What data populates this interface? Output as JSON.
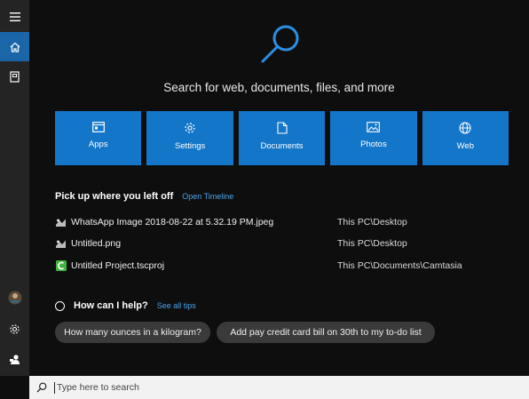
{
  "rail": {
    "items": [
      {
        "icon": "hamburger-menu-icon"
      },
      {
        "icon": "home-icon",
        "active": true
      },
      {
        "icon": "notebook-icon"
      },
      {
        "icon": "user-avatar-icon"
      },
      {
        "icon": "gear-icon"
      },
      {
        "icon": "feedback-icon"
      }
    ]
  },
  "main": {
    "headline": "Search for web, documents, files, and more",
    "tiles": [
      {
        "label": "Apps",
        "icon": "apps-icon"
      },
      {
        "label": "Settings",
        "icon": "settings-gear-icon"
      },
      {
        "label": "Documents",
        "icon": "document-icon"
      },
      {
        "label": "Photos",
        "icon": "photo-icon"
      },
      {
        "label": "Web",
        "icon": "globe-icon"
      }
    ],
    "recent": {
      "title": "Pick up where you left off",
      "link": "Open Timeline",
      "items": [
        {
          "name": "WhatsApp Image 2018-08-22 at 5.32.19 PM.jpeg",
          "path": "This PC\\Desktop",
          "icon": "image-file-icon"
        },
        {
          "name": "Untitled.png",
          "path": "This PC\\Desktop",
          "icon": "image-file-icon"
        },
        {
          "name": "Untitled Project.tscproj",
          "path": "This PC\\Documents\\Camtasia",
          "icon": "camtasia-file-icon"
        }
      ]
    },
    "help": {
      "title": "How can I help?",
      "link": "See all tips",
      "suggestions": [
        "How many ounces in a kilogram?",
        "Add pay credit card bill on 30th to my to-do list"
      ]
    }
  },
  "search": {
    "placeholder": "Type here to search",
    "value": ""
  },
  "colors": {
    "accent": "#1476c8",
    "rail_active": "#1a66a8",
    "background": "#0e0e0e",
    "link": "#4aa3ea"
  }
}
